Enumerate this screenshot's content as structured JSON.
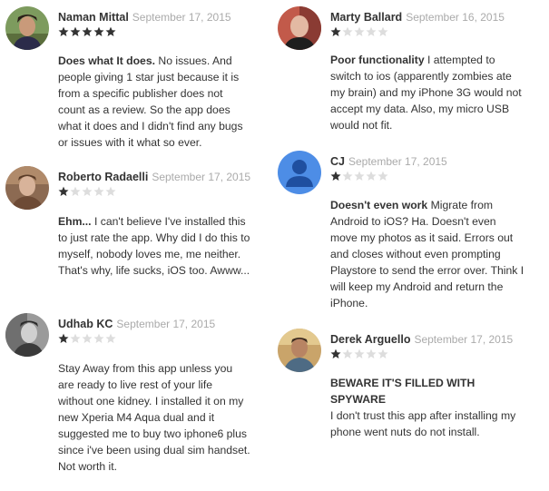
{
  "reviews_left": [
    {
      "author": "Naman Mittal",
      "date": "September 17, 2015",
      "rating": 5,
      "title": "Does what It does.",
      "text": "No issues. And people giving 1 star just because it is from a specific publisher does not count as a review. So the app does what it does and I didn't find any bugs or issues with it what so ever."
    },
    {
      "author": "Roberto Radaelli",
      "date": "September 17, 2015",
      "rating": 1,
      "title": "Ehm...",
      "text": "I can't believe I've installed this to just rate the app. Why did I do this to myself, nobody loves me, me neither. That's why, life sucks, iOS too. Awww..."
    },
    {
      "author": "Udhab KC",
      "date": "September 17, 2015",
      "rating": 1,
      "title": "",
      "text": "Stay Away from this app unless you are ready to live rest of your life without one kidney. I installed it on my new Xperia M4 Aqua dual and it suggested me to buy two iphone6 plus since i've been using dual sim handset. Not worth it."
    }
  ],
  "reviews_right": [
    {
      "author": "Marty Ballard",
      "date": "September 16, 2015",
      "rating": 1,
      "title": "Poor functionality",
      "text": "I attempted to switch to ios (apparently zombies ate my brain) and my iPhone 3G would not accept my data. Also, my micro USB would not fit."
    },
    {
      "author": "CJ",
      "date": "September 17, 2015",
      "rating": 1,
      "title": "Doesn't even work",
      "text": "Migrate from Android to iOS? Ha. Doesn't even move my photos as it said. Errors out and closes without even prompting Playstore to send the error over. Think I will keep my Android and return the iPhone."
    },
    {
      "author": "Derek Arguello",
      "date": "September 17, 2015",
      "rating": 1,
      "title": "BEWARE IT'S FILLED WITH SPYWARE",
      "text": "I don't trust this app after installing my phone went nuts do not install."
    }
  ],
  "colors": {
    "star_filled": "#333333",
    "star_empty": "#dddddd",
    "date": "#aaaaaa",
    "default_avatar_bg": "#4d8de6"
  },
  "max_rating": 5
}
